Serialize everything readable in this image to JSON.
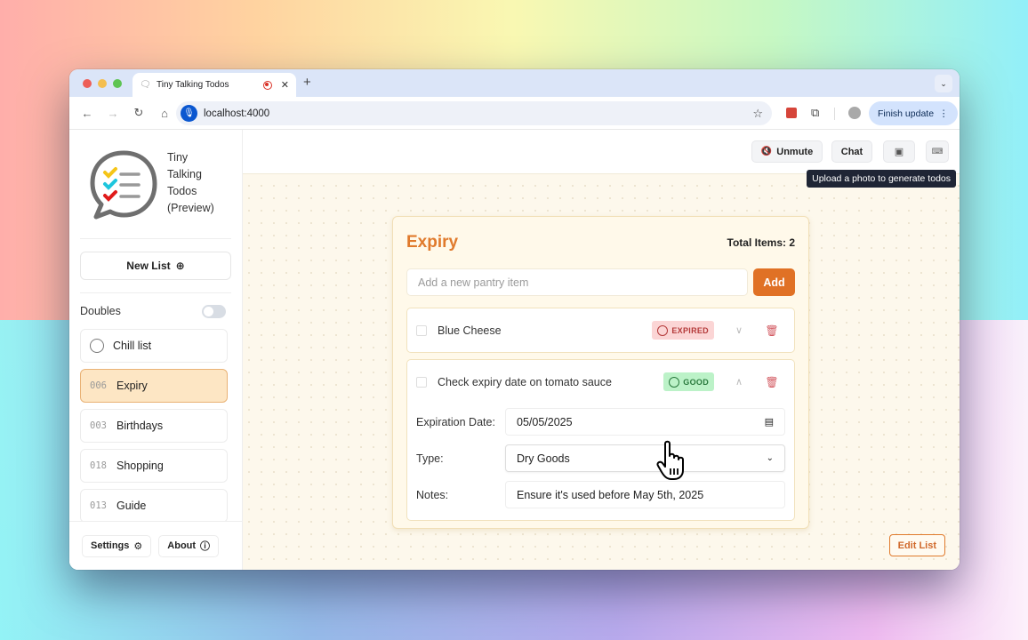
{
  "browser": {
    "tab_title": "Tiny Talking Todos",
    "tab_favicon": "chat-bubble-icon",
    "url": "localhost:4000",
    "finish_update_label": "Finish update",
    "icons": [
      "back-icon",
      "forward-icon",
      "reload-icon",
      "home-icon",
      "mic-icon",
      "star-icon",
      "extension-icon",
      "puzzle-icon",
      "profile-icon",
      "kebab-icon"
    ]
  },
  "sidebar": {
    "app_name_lines": [
      "Tiny",
      "Talking",
      "Todos",
      "(Preview)"
    ],
    "new_list_label": "New List",
    "doubles_label": "Doubles",
    "doubles_on": false,
    "lists": [
      {
        "num": "",
        "label": "Chill list",
        "icon": "chat-icon",
        "active": false
      },
      {
        "num": "006",
        "label": "Expiry",
        "active": true
      },
      {
        "num": "003",
        "label": "Birthdays",
        "active": false
      },
      {
        "num": "018",
        "label": "Shopping",
        "active": false
      },
      {
        "num": "013",
        "label": "Guide",
        "active": false
      }
    ],
    "settings_label": "Settings",
    "about_label": "About"
  },
  "topbar": {
    "unmute_label": "Unmute",
    "chat_label": "Chat",
    "tooltip": "Upload a photo to generate todos"
  },
  "card": {
    "title": "Expiry",
    "total_label": "Total Items: 2",
    "add_placeholder": "Add a new pantry item",
    "add_label": "Add",
    "items": [
      {
        "name": "Blue Cheese",
        "status": "EXPIRED",
        "expanded": false
      },
      {
        "name": "Check expiry date on tomato sauce",
        "status": "GOOD",
        "expanded": true,
        "details": {
          "expiration_label": "Expiration Date:",
          "expiration_value": "05/05/2025",
          "type_label": "Type:",
          "type_value": "Dry Goods",
          "notes_label": "Notes:",
          "notes_value": "Ensure it's used before May 5th, 2025"
        }
      }
    ]
  },
  "edit_list_label": "Edit List",
  "colors": {
    "accent": "#e07125",
    "active_list_bg": "#fde6c4",
    "expired_bg": "#fbd5d5",
    "good_bg": "#bcf2c8"
  }
}
